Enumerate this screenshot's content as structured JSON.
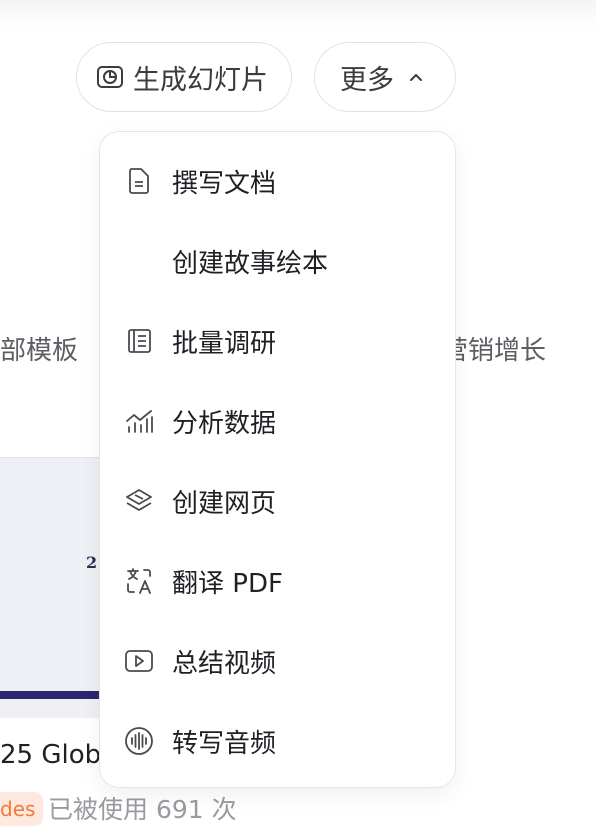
{
  "toolbar": {
    "slides_label": "生成幻灯片",
    "more_label": "更多"
  },
  "menu": {
    "items": [
      {
        "label": "撰写文档",
        "icon": "document-icon"
      },
      {
        "label": "创建故事绘本",
        "icon": ""
      },
      {
        "label": "批量调研",
        "icon": "book-icon"
      },
      {
        "label": "分析数据",
        "icon": "chart-icon"
      },
      {
        "label": "创建网页",
        "icon": "layers-icon"
      },
      {
        "label": "翻译 PDF",
        "icon": "translate-icon"
      },
      {
        "label": "总结视频",
        "icon": "video-icon"
      },
      {
        "label": "转写音频",
        "icon": "audio-wave-icon"
      }
    ]
  },
  "background": {
    "left_category": "部模板",
    "right_category": "营销增长",
    "card_mark": "2",
    "card_title": "25 Glob",
    "tag": "des",
    "usage": "已被使用 691 次"
  },
  "colors": {
    "accent_bar": "#2b2770",
    "tag_text": "#f07a3a",
    "tag_bg": "#fde9dd"
  }
}
